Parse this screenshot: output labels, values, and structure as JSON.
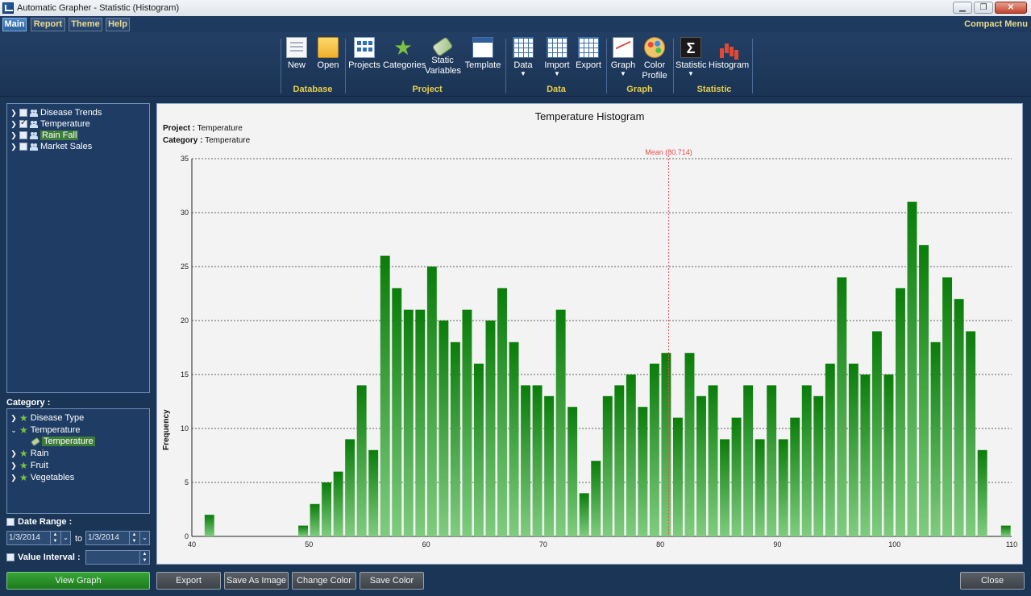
{
  "window": {
    "title": "Automatic Grapher - Statistic (Histogram)",
    "minimize": "▁",
    "maximize": "❐",
    "close": "✕"
  },
  "menu": {
    "items": [
      "Main",
      "Report",
      "Theme",
      "Help"
    ],
    "active": "Main",
    "compact_menu": "Compact Menu"
  },
  "ribbon": {
    "buttons": {
      "new": "New",
      "open": "Open",
      "projects": "Projects",
      "categories": "Categories",
      "static_line1": "Static",
      "static_line2": "Variables",
      "template": "Template",
      "data": "Data",
      "import": "Import",
      "export": "Export",
      "graph": "Graph",
      "color_line1": "Color",
      "color_line2": "Profile",
      "statistic": "Statistic",
      "histogram": "Histogram"
    },
    "groups": {
      "database": "Database",
      "project": "Project",
      "data": "Data",
      "graph": "Graph",
      "statistic": "Statistic"
    }
  },
  "projects_tree": [
    {
      "label": "Disease Trends",
      "checked": false
    },
    {
      "label": "Temperature",
      "checked": true
    },
    {
      "label": "Rain Fall",
      "checked": false,
      "selected": true
    },
    {
      "label": "Market Sales",
      "checked": false
    }
  ],
  "category": {
    "label": "Category :",
    "items": [
      "Disease Type",
      "Temperature",
      "Temperature",
      "Rain",
      "Fruit",
      "Vegetables"
    ]
  },
  "options": {
    "date_range_label": "Date Range :",
    "date_from": "1/3/2014",
    "to_label": "to",
    "date_to": "1/3/2014",
    "value_interval_label": "Value Interval :",
    "value_interval": ""
  },
  "buttons": {
    "view_graph": "View Graph",
    "export": "Export",
    "save_as_image": "Save As Image",
    "change_color": "Change Color",
    "save_color": "Save Color",
    "close": "Close"
  },
  "chart_info": {
    "project_label": "Project :",
    "project_value": "Temperature",
    "category_label": "Category :",
    "category_value": "Temperature"
  },
  "colors": {
    "bar_top": "#0a7d0a",
    "bar_bottom": "#7fcc7f",
    "mean_line": "#e85050"
  },
  "chart_data": {
    "type": "bar",
    "title": "Temperature Histogram",
    "xlabel": "",
    "ylabel": "Frequency",
    "xlim": [
      40,
      110
    ],
    "ylim": [
      0,
      35
    ],
    "xticks": [
      40,
      50,
      60,
      70,
      80,
      90,
      100,
      110
    ],
    "yticks": [
      0,
      5,
      10,
      15,
      20,
      25,
      30,
      35
    ],
    "grid": "horizontal dashed",
    "mean": {
      "label": "Mean (80.714)",
      "value": 80.714
    },
    "bars": [
      {
        "x": 41.5,
        "y": 2
      },
      {
        "x": 49.5,
        "y": 1
      },
      {
        "x": 50.5,
        "y": 3
      },
      {
        "x": 51.5,
        "y": 5
      },
      {
        "x": 52.5,
        "y": 6
      },
      {
        "x": 53.5,
        "y": 9
      },
      {
        "x": 54.5,
        "y": 14
      },
      {
        "x": 55.5,
        "y": 8
      },
      {
        "x": 56.5,
        "y": 26
      },
      {
        "x": 57.5,
        "y": 23
      },
      {
        "x": 58.5,
        "y": 21
      },
      {
        "x": 59.5,
        "y": 21
      },
      {
        "x": 60.5,
        "y": 25
      },
      {
        "x": 61.5,
        "y": 20
      },
      {
        "x": 62.5,
        "y": 18
      },
      {
        "x": 63.5,
        "y": 21
      },
      {
        "x": 64.5,
        "y": 16
      },
      {
        "x": 65.5,
        "y": 20
      },
      {
        "x": 66.5,
        "y": 23
      },
      {
        "x": 67.5,
        "y": 18
      },
      {
        "x": 68.5,
        "y": 14
      },
      {
        "x": 69.5,
        "y": 14
      },
      {
        "x": 70.5,
        "y": 13
      },
      {
        "x": 71.5,
        "y": 21
      },
      {
        "x": 72.5,
        "y": 12
      },
      {
        "x": 73.5,
        "y": 4
      },
      {
        "x": 74.5,
        "y": 7
      },
      {
        "x": 75.5,
        "y": 13
      },
      {
        "x": 76.5,
        "y": 14
      },
      {
        "x": 77.5,
        "y": 15
      },
      {
        "x": 78.5,
        "y": 12
      },
      {
        "x": 79.5,
        "y": 16
      },
      {
        "x": 80.5,
        "y": 17
      },
      {
        "x": 81.5,
        "y": 11
      },
      {
        "x": 82.5,
        "y": 17
      },
      {
        "x": 83.5,
        "y": 13
      },
      {
        "x": 84.5,
        "y": 14
      },
      {
        "x": 85.5,
        "y": 9
      },
      {
        "x": 86.5,
        "y": 11
      },
      {
        "x": 87.5,
        "y": 14
      },
      {
        "x": 88.5,
        "y": 9
      },
      {
        "x": 89.5,
        "y": 14
      },
      {
        "x": 90.5,
        "y": 9
      },
      {
        "x": 91.5,
        "y": 11
      },
      {
        "x": 92.5,
        "y": 14
      },
      {
        "x": 93.5,
        "y": 13
      },
      {
        "x": 94.5,
        "y": 16
      },
      {
        "x": 95.5,
        "y": 24
      },
      {
        "x": 96.5,
        "y": 16
      },
      {
        "x": 97.5,
        "y": 15
      },
      {
        "x": 98.5,
        "y": 19
      },
      {
        "x": 99.5,
        "y": 15
      },
      {
        "x": 100.5,
        "y": 23
      },
      {
        "x": 101.5,
        "y": 31
      },
      {
        "x": 102.5,
        "y": 27
      },
      {
        "x": 103.5,
        "y": 18
      },
      {
        "x": 104.5,
        "y": 24
      },
      {
        "x": 105.5,
        "y": 22
      },
      {
        "x": 106.5,
        "y": 19
      },
      {
        "x": 107.5,
        "y": 8
      },
      {
        "x": 109.5,
        "y": 1
      }
    ]
  }
}
